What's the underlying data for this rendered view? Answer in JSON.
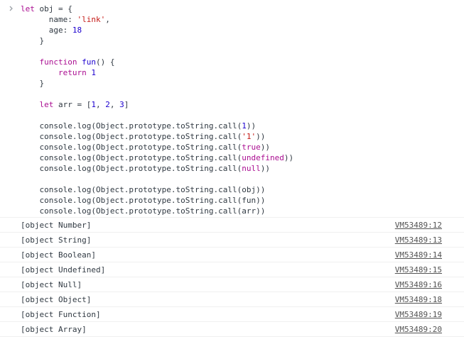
{
  "console": {
    "input_lines": [
      [
        {
          "t": "kw",
          "v": "let "
        },
        {
          "t": "plain",
          "v": "obj = {"
        }
      ],
      [
        {
          "t": "plain",
          "v": "      name: "
        },
        {
          "t": "str",
          "v": "'link'"
        },
        {
          "t": "plain",
          "v": ","
        }
      ],
      [
        {
          "t": "plain",
          "v": "      age: "
        },
        {
          "t": "num",
          "v": "18"
        }
      ],
      [
        {
          "t": "plain",
          "v": "    }"
        }
      ],
      [
        {
          "t": "plain",
          "v": ""
        }
      ],
      [
        {
          "t": "plain",
          "v": "    "
        },
        {
          "t": "kw",
          "v": "function "
        },
        {
          "t": "def",
          "v": "fun"
        },
        {
          "t": "plain",
          "v": "() {"
        }
      ],
      [
        {
          "t": "plain",
          "v": "        "
        },
        {
          "t": "kw",
          "v": "return "
        },
        {
          "t": "num",
          "v": "1"
        }
      ],
      [
        {
          "t": "plain",
          "v": "    }"
        }
      ],
      [
        {
          "t": "plain",
          "v": ""
        }
      ],
      [
        {
          "t": "plain",
          "v": "    "
        },
        {
          "t": "kw",
          "v": "let "
        },
        {
          "t": "plain",
          "v": "arr = ["
        },
        {
          "t": "num",
          "v": "1"
        },
        {
          "t": "plain",
          "v": ", "
        },
        {
          "t": "num",
          "v": "2"
        },
        {
          "t": "plain",
          "v": ", "
        },
        {
          "t": "num",
          "v": "3"
        },
        {
          "t": "plain",
          "v": "]"
        }
      ],
      [
        {
          "t": "plain",
          "v": ""
        }
      ],
      [
        {
          "t": "plain",
          "v": "    console.log(Object.prototype.toString.call("
        },
        {
          "t": "num",
          "v": "1"
        },
        {
          "t": "plain",
          "v": "))"
        }
      ],
      [
        {
          "t": "plain",
          "v": "    console.log(Object.prototype.toString.call("
        },
        {
          "t": "str",
          "v": "'1'"
        },
        {
          "t": "plain",
          "v": "))"
        }
      ],
      [
        {
          "t": "plain",
          "v": "    console.log(Object.prototype.toString.call("
        },
        {
          "t": "kw",
          "v": "true"
        },
        {
          "t": "plain",
          "v": "))"
        }
      ],
      [
        {
          "t": "plain",
          "v": "    console.log(Object.prototype.toString.call("
        },
        {
          "t": "kw",
          "v": "undefined"
        },
        {
          "t": "plain",
          "v": "))"
        }
      ],
      [
        {
          "t": "plain",
          "v": "    console.log(Object.prototype.toString.call("
        },
        {
          "t": "kw",
          "v": "null"
        },
        {
          "t": "plain",
          "v": "))"
        }
      ],
      [
        {
          "t": "plain",
          "v": ""
        }
      ],
      [
        {
          "t": "plain",
          "v": "    console.log(Object.prototype.toString.call(obj))"
        }
      ],
      [
        {
          "t": "plain",
          "v": "    console.log(Object.prototype.toString.call(fun))"
        }
      ],
      [
        {
          "t": "plain",
          "v": "    console.log(Object.prototype.toString.call(arr))"
        }
      ]
    ],
    "outputs": [
      {
        "text": "[object Number]",
        "source": "VM53489:12"
      },
      {
        "text": "[object String]",
        "source": "VM53489:13"
      },
      {
        "text": "[object Boolean]",
        "source": "VM53489:14"
      },
      {
        "text": "[object Undefined]",
        "source": "VM53489:15"
      },
      {
        "text": "[object Null]",
        "source": "VM53489:16"
      },
      {
        "text": "[object Object]",
        "source": "VM53489:18"
      },
      {
        "text": "[object Function]",
        "source": "VM53489:19"
      },
      {
        "text": "[object Array]",
        "source": "VM53489:20"
      }
    ]
  },
  "colors": {
    "keyword": "#aa0d91",
    "string": "#c41a16",
    "number": "#1c00cf",
    "text": "#303942",
    "source_link": "#545454"
  },
  "icons": {
    "prompt": "chevron-right-icon"
  }
}
